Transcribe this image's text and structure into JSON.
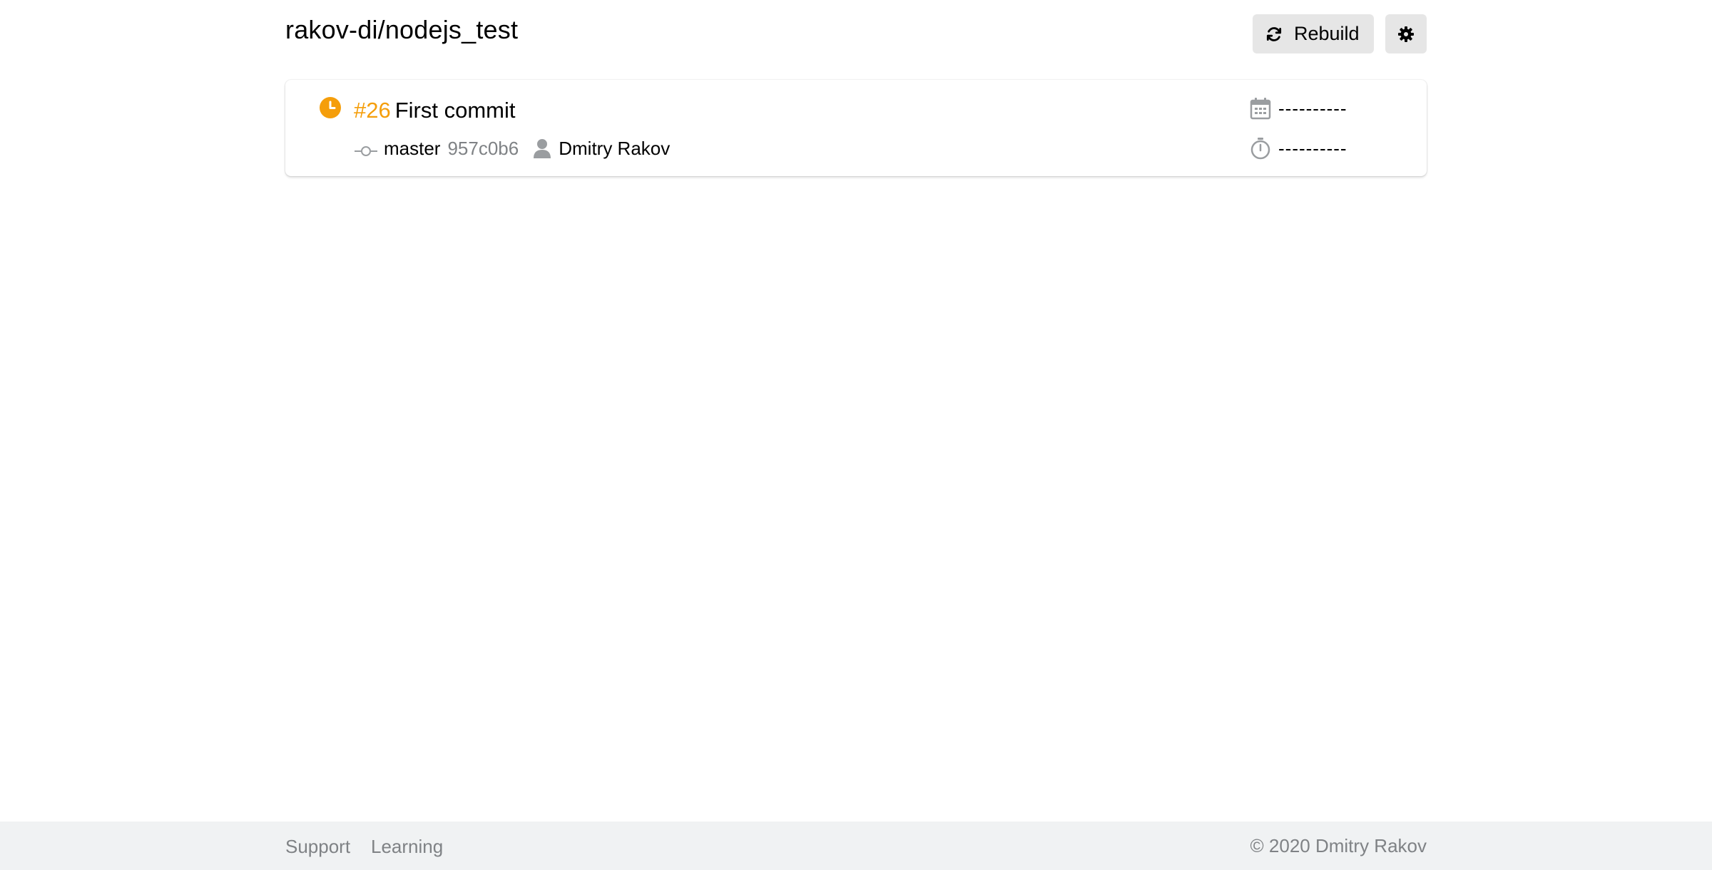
{
  "header": {
    "repo_title": "rakov-di/nodejs_test",
    "rebuild_label": "Rebuild",
    "rebuild_icon": "refresh-icon",
    "settings_icon": "gear-icon"
  },
  "build": {
    "status": "pending",
    "status_icon": "clock-icon",
    "status_color": "#f59e0b",
    "number": "#26",
    "message": "First commit",
    "branch": "master",
    "commit_hash": "957c0b6",
    "author": "Dmitry Rakov",
    "date": "----------",
    "duration": "----------"
  },
  "footer": {
    "links": [
      "Support",
      "Learning"
    ],
    "copyright": "© 2020 Dmitry Rakov"
  },
  "colors": {
    "accent_pending": "#f59e0b",
    "button_bg": "#e6e6e6",
    "muted_text": "#7f8285",
    "footer_bg": "#f0f2f3"
  }
}
